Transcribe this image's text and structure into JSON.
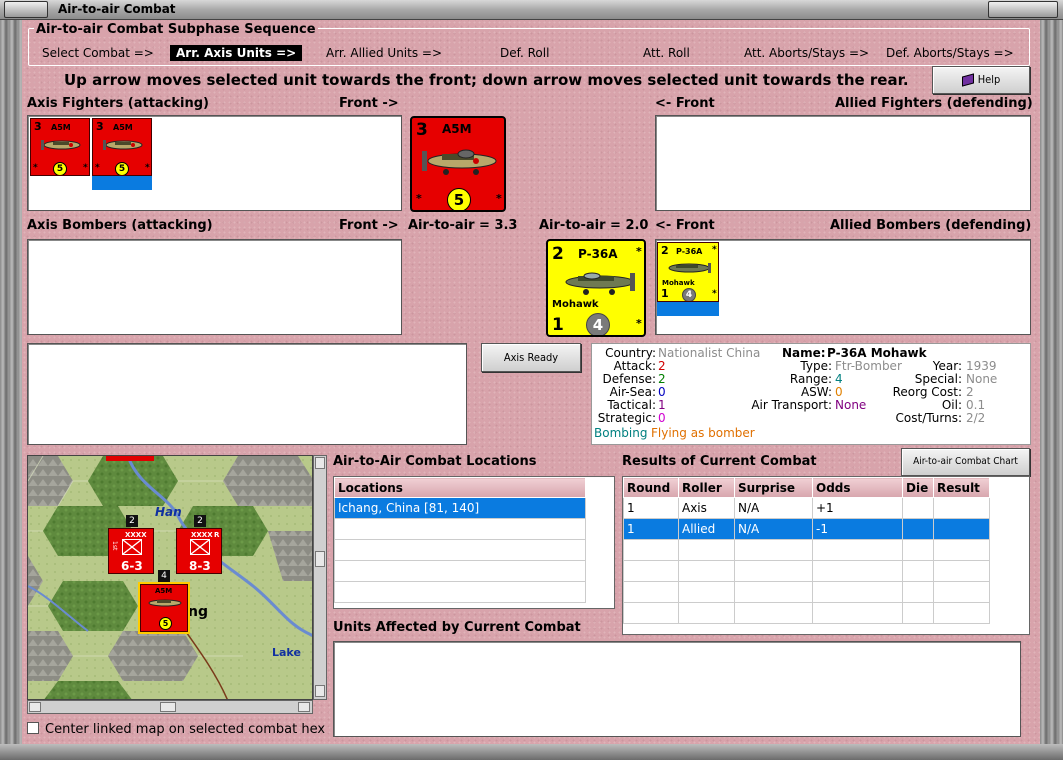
{
  "window": {
    "title": "Air-to-air Combat"
  },
  "subphase": {
    "title": "Air-to-air Combat Subphase Sequence",
    "steps": [
      "Select Combat =>",
      "Arr. Axis Units =>",
      "Arr. Allied Units =>",
      "Def. Roll",
      "Att. Roll",
      "Att. Aborts/Stays =>",
      "Def. Aborts/Stays =>"
    ],
    "active_step": "Arr. Axis Units =>"
  },
  "instruction": "Up arrow moves selected unit towards the front; down arrow moves selected unit towards the rear.",
  "help_label": "Help",
  "labels": {
    "axis_fighters": "Axis Fighters (attacking)",
    "front_right": "Front ->",
    "front_left": "<- Front",
    "allied_fighters": "Allied Fighters (defending)",
    "axis_bombers": "Axis Bombers (attacking)",
    "allied_bombers": "Allied Bombers (defending)",
    "axis_air_to_air": "Air-to-air = 3.3",
    "allied_air_to_air": "Air-to-air = 2.0"
  },
  "axis_counter": {
    "strength": "3",
    "name": "A5M",
    "value": "5",
    "star": "*"
  },
  "allied_counter": {
    "strength": "2",
    "name": "P-36A",
    "subname": "Mohawk",
    "bottom": "1",
    "value": "4",
    "star": "*"
  },
  "axis_ready_label": "Axis Ready",
  "unit_info": {
    "country_label": "Country:",
    "country": "Nationalist China",
    "attack_label": "Attack:",
    "attack": "2",
    "defense_label": "Defense:",
    "defense": "2",
    "airsea_label": "Air-Sea:",
    "airsea": "0",
    "tactical_label": "Tactical:",
    "tactical": "1",
    "strategic_label": "Strategic:",
    "strategic": "0",
    "name_label": "Name:",
    "name": "P-36A Mohawk",
    "type_label": "Type:",
    "type": "Ftr-Bomber",
    "range_label": "Range:",
    "range": "4",
    "asw_label": "ASW:",
    "asw": "0",
    "airtransport_label": "Air Transport:",
    "airtransport": "None",
    "year_label": "Year:",
    "year": "1939",
    "special_label": "Special:",
    "special": "None",
    "reorg_label": "Reorg Cost:",
    "reorg": "2",
    "oil_label": "Oil:",
    "oil": "0.1",
    "cost_label": "Cost/Turns:",
    "cost": "2/2",
    "bombing": "Bombing",
    "flying": "Flying as bomber",
    "colors": {
      "attack": "#d00000",
      "defense": "#008000",
      "airsea": "#0000c0",
      "tactical": "#800080",
      "strategic": "#d000d0",
      "range": "#008080",
      "asw": "#e08000",
      "airtransport": "#800080",
      "muted": "#8c8c8c",
      "bombing": "#008080",
      "flying": "#e07000"
    }
  },
  "locations": {
    "title": "Air-to-Air Combat Locations",
    "header": "Locations",
    "rows": [
      "Ichang, China [81, 140]"
    ]
  },
  "results": {
    "title": "Results of Current Combat",
    "chart_button": "Air-to-air Combat Chart",
    "headers": [
      "Round",
      "Roller",
      "Surprise",
      "Odds",
      "Die",
      "Result"
    ],
    "rows": [
      [
        "1",
        "Axis",
        "N/A",
        "+1",
        "",
        ""
      ],
      [
        "1",
        "Allied",
        "N/A",
        "-1",
        "",
        ""
      ]
    ],
    "selected_row": 1
  },
  "affected_title": "Units Affected by Current Combat",
  "map": {
    "river_label": "Han",
    "lake_label": "Lake",
    "city_fragment": "ng",
    "units": [
      {
        "stack": "2",
        "size": "XXXX",
        "label": "6-3",
        "side": "1st"
      },
      {
        "stack": "2",
        "size": "XXXX",
        "label": "8-3",
        "side": "R"
      },
      {
        "stack": "4",
        "name": "A5M",
        "value": "5"
      }
    ]
  },
  "center_checkbox_label": "Center linked map on selected combat hex"
}
